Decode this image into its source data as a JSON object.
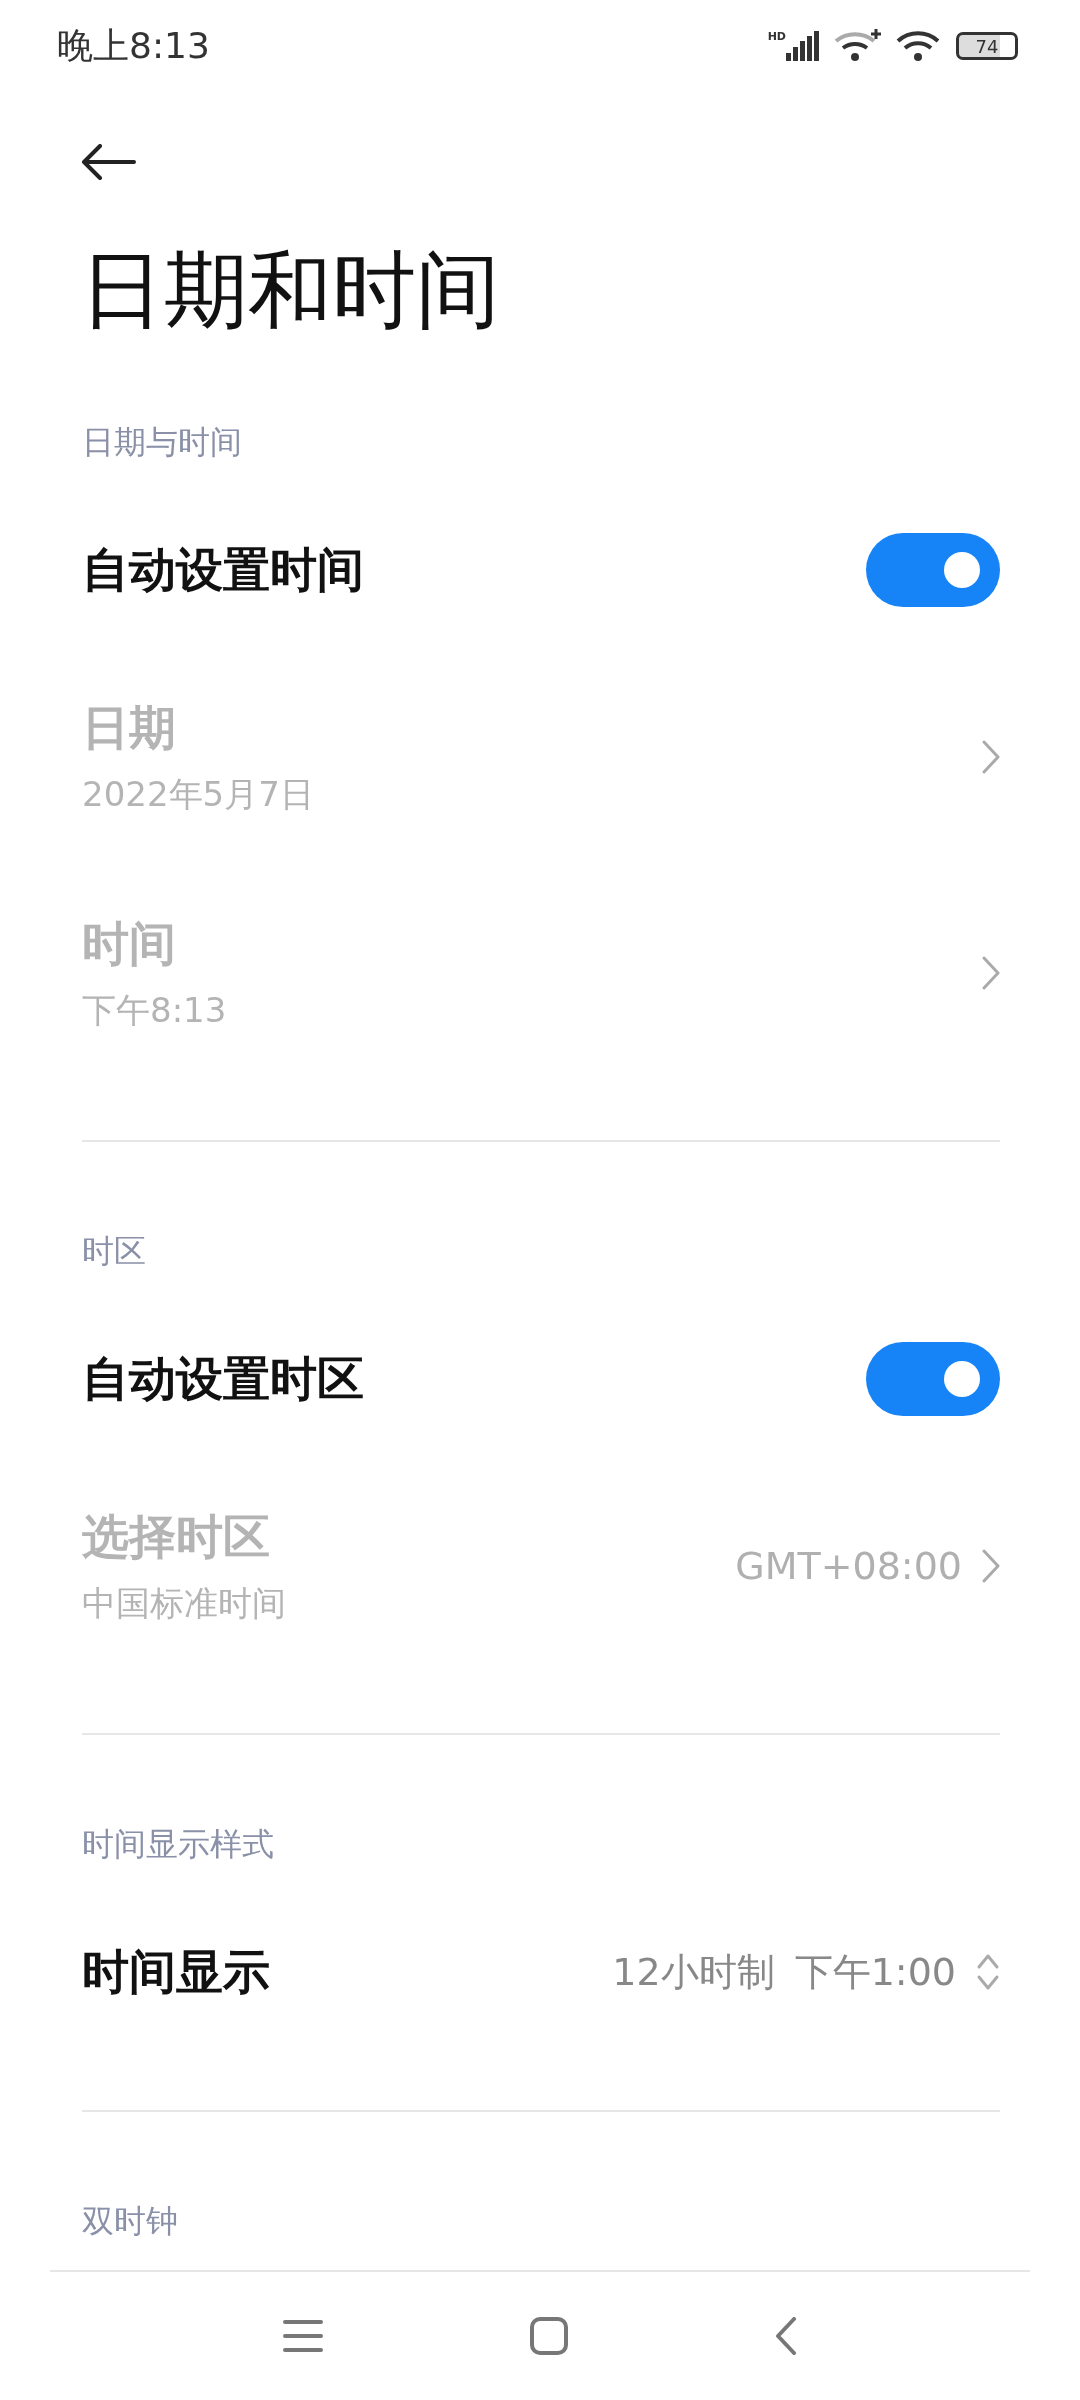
{
  "status_bar": {
    "time": "晚上8:13",
    "signal_label": "HD",
    "battery": "74"
  },
  "title": "日期和时间",
  "sections": [
    {
      "header": "日期与时间",
      "items": [
        {
          "kind": "toggle",
          "label": "自动设置时间",
          "on": true,
          "disabled": false
        },
        {
          "kind": "link",
          "label": "日期",
          "subtitle": "2022年5月7日",
          "disabled": true
        },
        {
          "kind": "link",
          "label": "时间",
          "subtitle": "下午8:13",
          "disabled": true
        }
      ]
    },
    {
      "header": "时区",
      "items": [
        {
          "kind": "toggle",
          "label": "自动设置时区",
          "on": true,
          "disabled": false
        },
        {
          "kind": "link",
          "label": "选择时区",
          "subtitle": "中国标准时间",
          "values": [
            "GMT+08:00"
          ],
          "disabled": true
        }
      ]
    },
    {
      "header": "时间显示样式",
      "items": [
        {
          "kind": "select",
          "label": "时间显示",
          "values": [
            "12小时制",
            "下午1:00"
          ],
          "disabled": false
        }
      ]
    },
    {
      "header": "双时钟"
    }
  ]
}
